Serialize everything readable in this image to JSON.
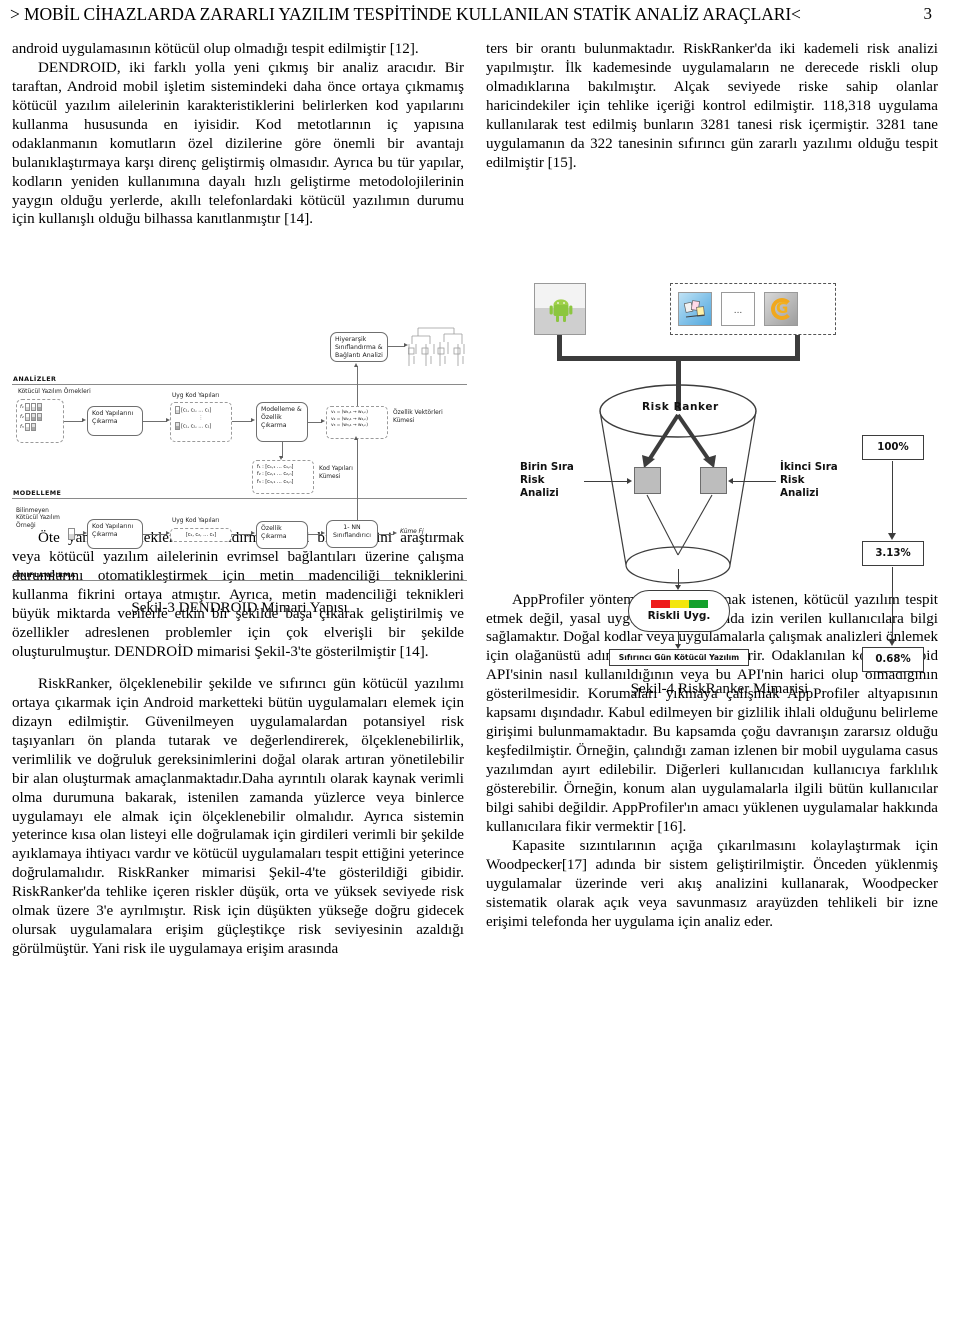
{
  "header": {
    "running_title": "> MOBİL CİHAZLARDA ZARARLI YAZILIM TESPİTİNDE KULLANILAN STATİK ANALİZ ARAÇLARI<",
    "page_number": "3"
  },
  "left_column": {
    "para_1": "android uygulamasının kötücül olup olmadığı tespit edilmiştir [12].",
    "para_2": "DENDROID, iki farklı yolla yeni çıkmış bir analiz aracıdır. Bir taraftan, Android mobil işletim sistemindeki daha önce ortaya çıkmamış kötücül yazılım ailelerinin karakteristiklerini belirlerken kod yapılarını kullanma hususunda en iyisidir. Kod metotlarının iç yapısına odaklanmanın komutların özel dizilerine göre önemli bir avantajı bulanıklaştırmaya karşı direnç geliştirmiş olmasıdır. Ayrıca bu tür yapılar, kodların yeniden kullanımına dayalı hızlı geliştirme metodolojilerinin yaygın olduğu yerlerde, akıllı telefonlardaki kötücül yazılımın durumu için kullanışlı olduğu bilhassa kanıtlanmıştır [14].",
    "figure_3_caption": "Şekil-3 DENDROID Mimari Yapısı",
    "para_3": "Öte yandan, örnekleri sınıflandırmak, kod bileşenlerini araştırmak veya kötücül yazılım ailelerinin evrimsel bağlantıları üzerine çalışma durumlarını otomatikleştirmek için metin madenciliği tekniklerini kullanma fikrini ortaya atmıştır. Ayrıca, metin madenciliği teknikleri büyük miktarda verilerle etkin bir şekilde başa çıkarak geliştirilmiş ve özellikler adreslenen problemler için çok elverişli bir şekilde oluşturulmuştur. DENDROİD mimarisi Şekil-3'te gösterilmiştir [14].",
    "para_4": "RiskRanker, ölçeklenebilir şekilde ve sıfırıncı gün kötücül yazılımı ortaya çıkarmak için Android marketteki bütün uygulamaları elemek için dizayn edilmiştir. Güvenilmeyen uygulamalardan potansiyel risk taşıyanları ön planda tutarak ve değerlendirerek, ölçeklenebilirlik, verimlilik ve doğruluk gereksinimlerini doğal olarak artıran yönetilebilir bir alan oluşturmak amaçlanmaktadır.Daha ayrıntılı olarak kaynak verimli olma durumuna bakarak, istenilen zamanda yüzlerce veya binlerce uygulamayı ele almak için ölçeklenebilir olmalıdır. Ayrıca sistemin yeterince kısa olan listeyi elle doğrulamak için girdileri verimli bir şekilde ayıklamaya ihtiyacı vardır ve kötücül uygulamaları tespit ettiğini yeterince doğrulamalıdır. RiskRanker mimarisi Şekil-4'te gösterildiği gibidir. RiskRanker'da tehlike içeren riskler düşük, orta ve yüksek seviyede risk olmak üzere 3'e ayrılmıştır. Risk için düşükten yükseğe doğru gidecek olursak uygulamalara erişim güçleştikçe risk seviyesinin azaldığı görülmüştür. Yani risk ile uygulamaya erişim arasında"
  },
  "right_column": {
    "para_1": "ters bir orantı bulunmaktadır. RiskRanker'da iki kademeli risk analizi yapılmıştır. İlk kademesinde    uygulamaların ne derecede riskli olup olmadıklarına bakılmıştır. Alçak seviyede riske sahip olanlar haricindekiler için tehlike içeriği kontrol edilmiştir. 118,318 uygulama kullanılarak test edilmiş bunların 3281 tanesi risk içermiştir. 3281 tane uygulamanın da 322 tanesinin sıfırıncı gün zararlı yazılımı olduğu tespit edilmiştir [15].",
    "figure_4_caption": "Şekil-4 RiskRanker Mimarisi",
    "para_2": "AppProfiler yönteminde vurgulanmak istenen, kötücül yazılım tespit etmek değil, yasal uygulamalar hakkında izin verilen kullanıcılara bilgi sağlamaktır. Doğal kodlar veya uygulamalarla çalışmak analizleri önlemek için olağanüstü adımlar atılmasını gerektirir. Odaklanılan konu Android API'sinin nasıl kullanıldığının veya bu API'nin harici olup olmadığının gösterilmesidir. Korumaları yıkmaya çalışmak AppProfiler altyapısının kapsamı dışındadır. Kabul edilmeyen bir gizlilik ihlali olduğunu belirleme girişimi bulunmamaktadır. Bu kapsamda çoğu davranışın zararsız olduğu keşfedilmiştir. Örneğin, çalındığı zaman izlenen bir mobil uygulama casus yazılımdan ayırt edilebilir. Diğerleri kullanıcıdan kullanıcıya farklılık gösterebilir. Örneğin, konum alan uygulamalarla ilgili bütün kullanıcılar bilgi sahibi değildir. AppProfiler'ın amacı yüklenen uygulamalar hakkında kullanıcılara fikir vermektir [16].",
    "para_3": "Kapasite sızıntılarının açığa çıkarılmasını kolaylaştırmak için Woodpecker[17] adında bir sistem geliştirilmiştir. Önceden yüklenmiş uygulamalar üzerinde veri akış analizini kullanarak, Woodpecker sistematik olarak açık veya savunmasız arayüzden tehlikeli bir izne erişimi telefonda her uygulama için analiz eder."
  },
  "figure_3": {
    "stages": {
      "analizler": "ANALİZLER",
      "modelleme": "MODELLEME",
      "siniflandirma": "SINIFLANDIRMA"
    },
    "labels": {
      "malware_samples": "Kötücül Yazılım Örnekleri",
      "unknown_sample": "Bilinmeyen\nKötücül Yazılım\nÖrneği",
      "code_extract_1": "Kod Yapılarını\nÇıkarma",
      "code_extract_2": "Kod Yapılarını\nÇıkarma",
      "app_code_struct_1": "Uyg Kod Yapıları",
      "app_code_struct_2": "Uyg Kod Yapıları",
      "modelling": "Modelleme &\nÖzellik\nÇıkarma",
      "feature_extract": "Özellik\nÇıkarma",
      "code_struct_set": "Kod Yapıları\nKümesi",
      "feature_vector_set": "Özellik Vektörleri\nKümesi",
      "hierarchical": "Hiyerarşik\nSınıflandırma &\nBağlantı Analizi",
      "nn_classifier": "1- NN\nSınıflandırıcı",
      "cluster_out": "Küme Fj"
    },
    "formulas": {
      "cs_row_1": "[c₁, c₂, … c₁]",
      "cs_row_2": "[c₁, c₂, … c₁]",
      "cs_single": "[c₁, c₂, … c₁]",
      "set_row_1": "f₁ : [c₁,₁ … c₁,ₙ]",
      "set_row_2": "f₂ : [c₂,₁ … c₂,ₙ]",
      "set_row_3": "f₃ : [c₃,₁ … c₃,ₙ]",
      "vec_row_1": "v₁ = (w₁,₁ → w₁,ₙ)",
      "vec_row_2": "v₂ = (w₂,₁ → w₂,ₙ)",
      "vec_row_3": "v₃ = (w₃,₁ → w₃,ₙ)"
    }
  },
  "figure_4": {
    "title": "Risk   Ranker",
    "labels": {
      "first_order": "Birin Sıra\nRisk\nAnalizi",
      "second_order": "İkinci Sıra\nRisk\nAnalizi",
      "risky_app": "Riskli Uyg.",
      "zero_day": "Sıfırıncı Gün Kötücül Yazılım",
      "ellipsis": "..."
    },
    "percentages": [
      "100%",
      "3.13%",
      "0.68%"
    ],
    "pill_colors": [
      "#ee1b1b",
      "#f3e60d",
      "#14a02c"
    ],
    "icons": {
      "android_market": "android-market-icon",
      "app_blue": "app-icon-blue",
      "app_placeholder": "app-icon-placeholder",
      "app_gold": "app-icon-gold"
    }
  }
}
